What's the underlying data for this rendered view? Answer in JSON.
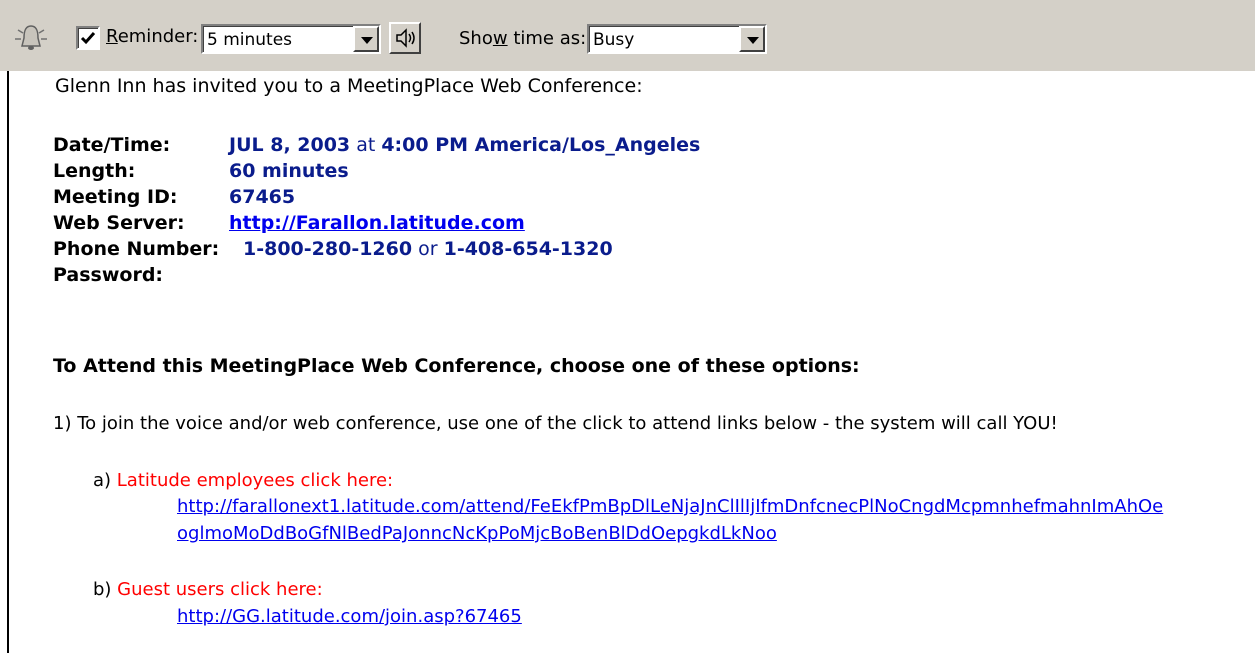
{
  "toolbar": {
    "reminder_checked": true,
    "reminder_label_pre": "",
    "reminder_label_u": "R",
    "reminder_label_post": "eminder:",
    "reminder_value": "5 minutes",
    "show_time_pre": "Sho",
    "show_time_u": "w",
    "show_time_post": " time as:",
    "show_time_value": "Busy"
  },
  "message": {
    "intro": "Glenn Inn has invited you to a MeetingPlace Web Conference:",
    "details": {
      "datetime_label": "Date/Time:",
      "datetime_date": "JUL 8, 2003",
      "datetime_at": " at ",
      "datetime_time": "4:00 PM America/Los_Angeles",
      "length_label": "Length:",
      "length_value": "60 minutes",
      "meeting_id_label": "Meeting ID:",
      "meeting_id_value": "67465",
      "web_server_label": "Web Server:",
      "web_server_value": "http://Farallon.latitude.com",
      "phone_label": "Phone Number:",
      "phone_1": "1-800-280-1260",
      "phone_or": " or ",
      "phone_2": "1-408-654-1320",
      "password_label": "Password:"
    },
    "attend_heading": "To Attend this MeetingPlace Web Conference, choose one of these options:",
    "option1": "1)  To join the voice and/or web conference, use one of the click to attend links below - the system will call YOU!",
    "option_a_prefix": "a) ",
    "option_a_label": "Latitude employees click here:",
    "option_a_link_line1": "http://farallonext1.latitude.com/attend/FeEkfPmBpDlLeNjaJnClIlIjIfmDnfcnecPlNoCngdMcpmnhefmahnImAhOe",
    "option_a_link_line2": "oglmoMoDdBoGfNlBedPaJonncNcKpPoMjcBoBenBlDdOepgkdLkNoo",
    "option_b_prefix": "b) ",
    "option_b_label": "Guest users click here:",
    "option_b_link": "http://GG.latitude.com/join.asp?67465"
  }
}
